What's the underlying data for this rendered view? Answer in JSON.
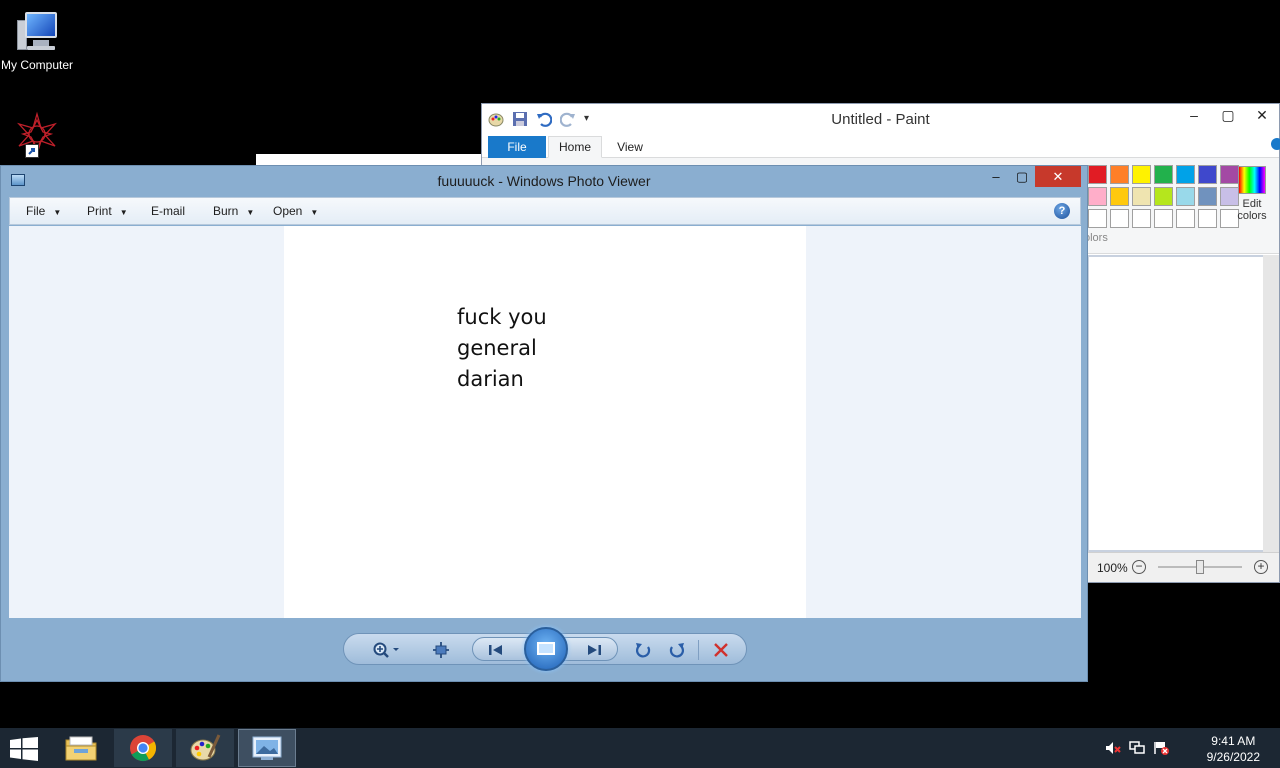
{
  "desktop": {
    "icons": [
      {
        "label": "My Computer",
        "icon": "my-computer-icon"
      },
      {
        "label": "",
        "icon": "star-shortcut-icon"
      }
    ]
  },
  "paint": {
    "title": "Untitled - Paint",
    "tabs": [
      "File",
      "Home",
      "View"
    ],
    "edit_colors_label": "Edit colors",
    "colors_label": "olors",
    "zoom": "100%",
    "zoom_level": 0.5,
    "palette": [
      "#e11c24",
      "#ff7f27",
      "#fff200",
      "#22b14c",
      "#00a2e8",
      "#3f48cc",
      "#a349a4",
      "#ffaec9",
      "#ffc90e",
      "#efe4b0",
      "#b5e61d",
      "#99d9ea",
      "#7092be",
      "#c8bfe7",
      "#ffffff",
      "#ffffff",
      "#ffffff",
      "#ffffff",
      "#ffffff",
      "#ffffff",
      "#ffffff"
    ]
  },
  "photo_viewer": {
    "title": "fuuuuuck - Windows Photo Viewer",
    "menu": {
      "file": "File",
      "print": "Print",
      "email": "E-mail",
      "burn": "Burn",
      "open": "Open"
    },
    "help": "?",
    "image_text": [
      "fuck you",
      "general",
      "darian"
    ]
  },
  "taskbar": {
    "apps": [
      "file-explorer-icon",
      "chrome-icon",
      "paint-icon",
      "photo-viewer-icon"
    ],
    "time": "9:41 AM",
    "date": "9/26/2022"
  }
}
